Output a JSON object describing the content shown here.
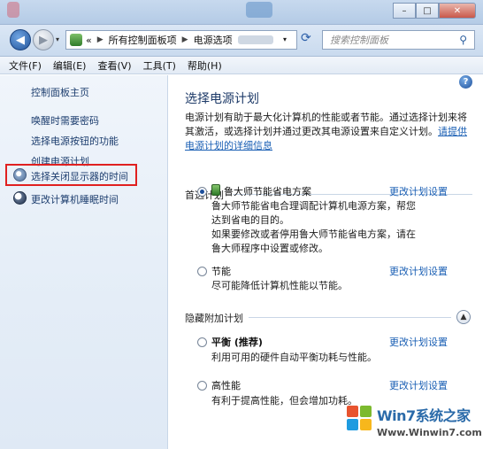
{
  "address": {
    "crumbs": [
      "所有控制面板项",
      "电源选项"
    ],
    "overflow": "«"
  },
  "search": {
    "placeholder": "搜索控制面板"
  },
  "window_buttons": {
    "minimize": "–",
    "maximize": "□",
    "close": "✕"
  },
  "menu": [
    "文件(F)",
    "编辑(E)",
    "查看(V)",
    "工具(T)",
    "帮助(H)"
  ],
  "sidebar": {
    "home": "控制面板主页",
    "items": [
      {
        "label": "唤醒时需要密码",
        "icon": null
      },
      {
        "label": "选择电源按钮的功能",
        "icon": null
      },
      {
        "label": "创建电源计划",
        "icon": null
      },
      {
        "label": "选择关闭显示器的时间",
        "icon": "display-clock-icon",
        "highlighted": true
      },
      {
        "label": "更改计算机睡眠时间",
        "icon": "moon-icon"
      }
    ]
  },
  "main": {
    "title": "选择电源计划",
    "description": "电源计划有助于最大化计算机的性能或者节能。通过选择计划来将其激活，或选择计划并通过更改其电源设置来自定义计划。",
    "description_link": "请提供电源计划的详细信息",
    "preferred_section": "首选计划",
    "hidden_section": "隐藏附加计划",
    "plans": [
      {
        "name": "鲁大师节能省电方案",
        "selected": true,
        "has_icon": true,
        "desc": [
          "鲁大师节能省电合理调配计算机电源方案，帮您达到省电的目的。",
          "如果要修改或者停用鲁大师节能省电方案，请在鲁大师程序中设置或修改。"
        ],
        "link": "更改计划设置"
      },
      {
        "name": "节能",
        "selected": false,
        "has_icon": false,
        "desc": [
          "尽可能降低计算机性能以节能。"
        ],
        "link": "更改计划设置"
      },
      {
        "name": "平衡 (推荐)",
        "selected": false,
        "has_icon": false,
        "desc": [
          "利用可用的硬件自动平衡功耗与性能。"
        ],
        "link": "更改计划设置"
      },
      {
        "name": "高性能",
        "selected": false,
        "has_icon": false,
        "desc": [
          "有利于提高性能，但会增加功耗。"
        ],
        "link": "更改计划设置"
      }
    ]
  },
  "watermark": {
    "brand": "Win7系统之家",
    "url": "Www.Winwin7.com"
  },
  "colors": {
    "link": "#1a5fb4",
    "title": "#1d3a68",
    "highlight_box": "#e02020"
  }
}
